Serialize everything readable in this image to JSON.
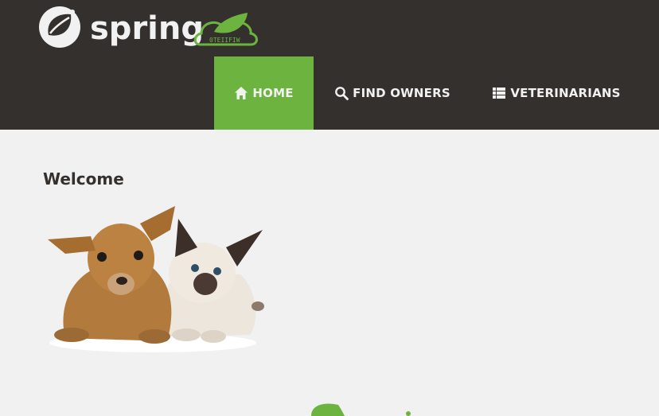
{
  "brand": {
    "name": "spring",
    "logo_icon": "spring-leaf-icon",
    "badge_icon": "petclinic-leaf-badge-icon",
    "badge_text": "0TEIIFIW",
    "colors": {
      "green": "#6db33f",
      "dark": "#34302d",
      "light": "#f1f1f1"
    }
  },
  "nav": {
    "items": [
      {
        "label": "HOME",
        "icon": "home-icon",
        "active": true
      },
      {
        "label": "FIND OWNERS",
        "icon": "search-icon",
        "active": false
      },
      {
        "label": "VETERINARIANS",
        "icon": "list-icon",
        "active": false
      }
    ]
  },
  "main": {
    "heading": "Welcome",
    "image": "pets-image"
  }
}
